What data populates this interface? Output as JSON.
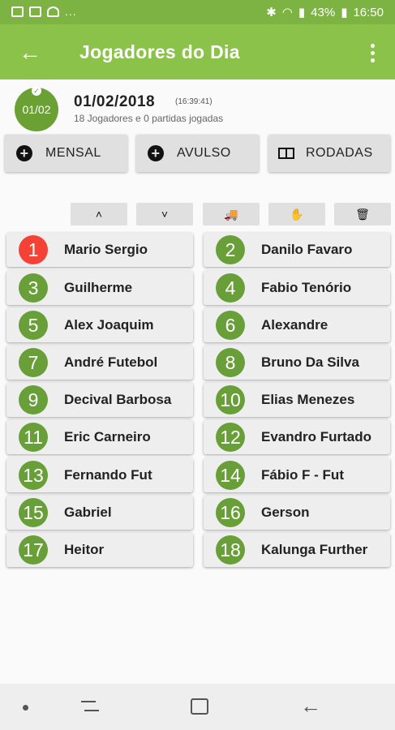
{
  "status_bar": {
    "battery": "43%",
    "time": "16:50",
    "more": "..."
  },
  "app_bar": {
    "title": "Jogadores do Dia"
  },
  "header": {
    "badge": "01/02",
    "date": "01/02/2018",
    "time": "(16:39:41)",
    "subtitle": "18 Jogadores e 0 partidas jogadas"
  },
  "actions": [
    {
      "label": "MENSAL",
      "icon": "plus-circle-icon"
    },
    {
      "label": "AVULSO",
      "icon": "plus-circle-icon"
    },
    {
      "label": "RODADAS",
      "icon": "scoreboard-icon"
    }
  ],
  "tools": [
    {
      "name": "move-up-button",
      "icon": "chevron-up-icon",
      "glyph": "˄"
    },
    {
      "name": "move-down-button",
      "icon": "chevron-down-icon",
      "glyph": "˅"
    },
    {
      "name": "transfer-button",
      "icon": "truck-icon",
      "glyph": "🚚"
    },
    {
      "name": "stop-button",
      "icon": "hand-icon",
      "glyph": "✋"
    },
    {
      "name": "delete-button",
      "icon": "trash-icon",
      "glyph": "🗑"
    }
  ],
  "players": [
    {
      "number": "1",
      "name": "Mario Sergio",
      "highlight": true
    },
    {
      "number": "2",
      "name": "Danilo Favaro"
    },
    {
      "number": "3",
      "name": "Guilherme"
    },
    {
      "number": "4",
      "name": "Fabio Tenório"
    },
    {
      "number": "5",
      "name": "Alex Joaquim"
    },
    {
      "number": "6",
      "name": "Alexandre"
    },
    {
      "number": "7",
      "name": "André Futebol"
    },
    {
      "number": "8",
      "name": "Bruno Da Silva"
    },
    {
      "number": "9",
      "name": "Decival Barbosa"
    },
    {
      "number": "10",
      "name": "Elias Menezes"
    },
    {
      "number": "11",
      "name": "Eric Carneiro"
    },
    {
      "number": "12",
      "name": "Evandro Furtado"
    },
    {
      "number": "13",
      "name": "Fernando Fut"
    },
    {
      "number": "14",
      "name": "Fábio F - Fut"
    },
    {
      "number": "15",
      "name": "Gabriel"
    },
    {
      "number": "16",
      "name": "Gerson"
    },
    {
      "number": "17",
      "name": "Heitor"
    },
    {
      "number": "18",
      "name": "Kalunga Further"
    }
  ],
  "colors": {
    "primary": "#8bc34a",
    "status": "#7cb342",
    "circle": "#689f38",
    "highlight": "#f44336"
  }
}
